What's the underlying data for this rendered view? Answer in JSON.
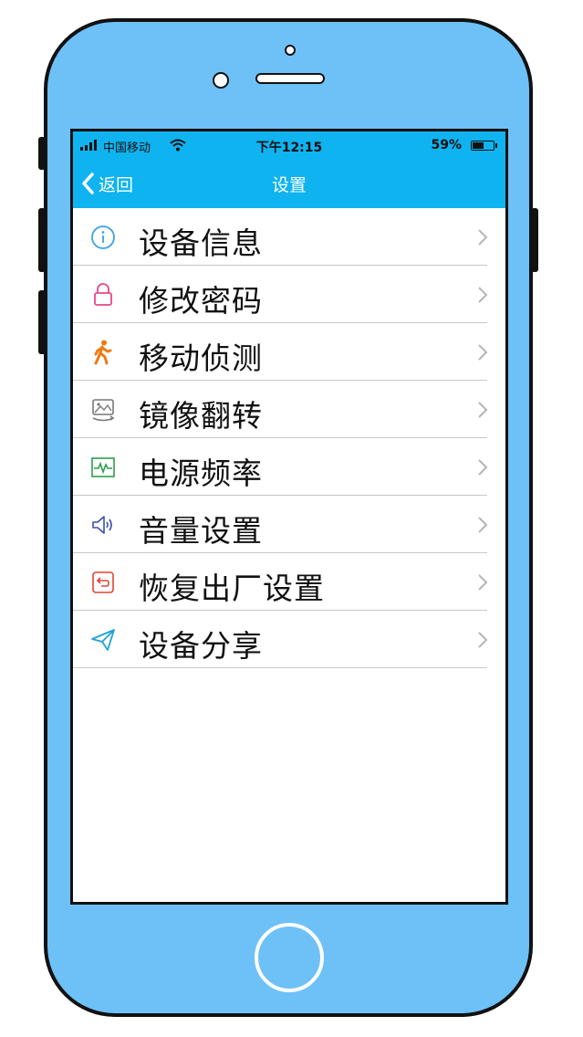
{
  "status_bar": {
    "carrier": "中国移动",
    "time": "下午12:15",
    "battery_percent": "59%",
    "battery_level": 0.59
  },
  "nav": {
    "back_label": "返回",
    "title": "设置"
  },
  "colors": {
    "bar": "#0fb3f0",
    "phone_body": "#6ec1f7"
  },
  "menu": {
    "items": [
      {
        "label": "设备信息",
        "icon": "info-icon"
      },
      {
        "label": "修改密码",
        "icon": "lock-icon"
      },
      {
        "label": "移动侦测",
        "icon": "walking-person-icon"
      },
      {
        "label": "镜像翻转",
        "icon": "image-flip-icon"
      },
      {
        "label": "电源频率",
        "icon": "waveform-icon"
      },
      {
        "label": "音量设置",
        "icon": "speaker-icon"
      },
      {
        "label": "恢复出厂设置",
        "icon": "reset-icon"
      },
      {
        "label": "设备分享",
        "icon": "paper-plane-icon"
      }
    ]
  }
}
